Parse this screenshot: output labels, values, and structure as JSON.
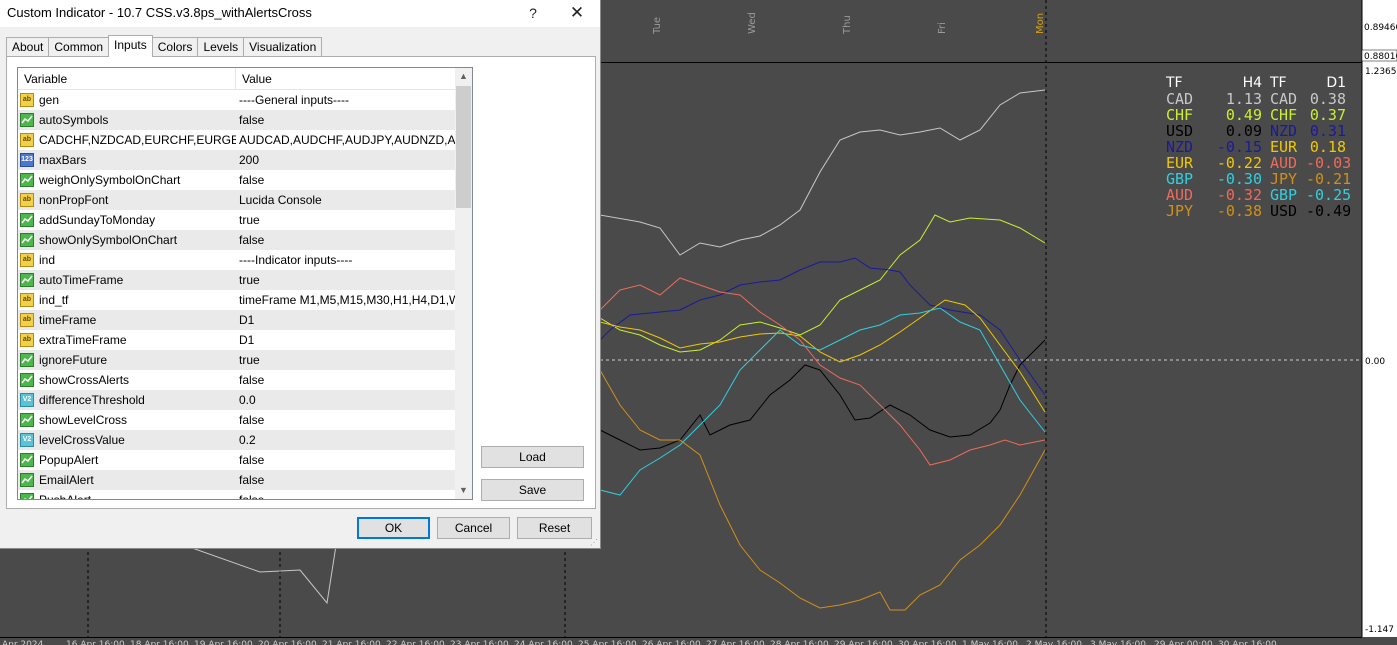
{
  "dialog": {
    "title": "Custom Indicator - 10.7 CSS.v3.8ps_withAlertsCross",
    "help_glyph": "?",
    "close_glyph": "✕",
    "tabs": [
      "About",
      "Common",
      "Inputs",
      "Colors",
      "Levels",
      "Visualization"
    ],
    "active_tab": "Inputs",
    "grid": {
      "col_variable": "Variable",
      "col_value": "Value",
      "rows": [
        {
          "type": "ab",
          "variable": "gen",
          "value": "----General inputs----"
        },
        {
          "type": "bool",
          "variable": "autoSymbols",
          "value": "false"
        },
        {
          "type": "ab",
          "variable": "CADCHF,NZDCAD,EURCHF,EURGBP,",
          "value": "AUDCAD,AUDCHF,AUDJPY,AUDNZD,A..."
        },
        {
          "type": "int",
          "variable": "maxBars",
          "value": "200"
        },
        {
          "type": "bool",
          "variable": "weighOnlySymbolOnChart",
          "value": "false"
        },
        {
          "type": "ab",
          "variable": "nonPropFont",
          "value": "Lucida Console"
        },
        {
          "type": "bool",
          "variable": "addSundayToMonday",
          "value": "true"
        },
        {
          "type": "bool",
          "variable": "showOnlySymbolOnChart",
          "value": "false"
        },
        {
          "type": "ab",
          "variable": "ind",
          "value": "----Indicator inputs----"
        },
        {
          "type": "bool",
          "variable": "autoTimeFrame",
          "value": "true"
        },
        {
          "type": "ab",
          "variable": "ind_tf",
          "value": "timeFrame M1,M5,M15,M30,H1,H4,D1,W..."
        },
        {
          "type": "ab",
          "variable": "timeFrame",
          "value": "D1"
        },
        {
          "type": "ab",
          "variable": "extraTimeFrame",
          "value": "D1"
        },
        {
          "type": "bool",
          "variable": "ignoreFuture",
          "value": "true"
        },
        {
          "type": "bool",
          "variable": "showCrossAlerts",
          "value": "false"
        },
        {
          "type": "dbl",
          "variable": "differenceThreshold",
          "value": "0.0"
        },
        {
          "type": "bool",
          "variable": "showLevelCross",
          "value": "false"
        },
        {
          "type": "dbl",
          "variable": "levelCrossValue",
          "value": "0.2"
        },
        {
          "type": "bool",
          "variable": "PopupAlert",
          "value": "false"
        },
        {
          "type": "bool",
          "variable": "EmailAlert",
          "value": "false"
        },
        {
          "type": "bool",
          "variable": "PushAlert",
          "value": "false"
        }
      ]
    },
    "buttons": {
      "load": "Load",
      "save": "Save",
      "ok": "OK",
      "cancel": "Cancel",
      "reset": "Reset"
    }
  },
  "chart": {
    "price_labels": [
      "0.89460",
      "0.88010",
      "1.2365",
      "0.00",
      "-1.147"
    ],
    "day_labels": [
      "Tue",
      "Wed",
      "Thu",
      "Fri",
      "Mon"
    ],
    "date_labels": [
      "Apr 2024",
      "16 Apr 16:00",
      "18 Apr 16:00",
      "19 Apr 16:00",
      "20 Apr 16:00",
      "21 Apr 16:00",
      "22 Apr 16:00",
      "23 Apr 16:00",
      "24 Apr 16:00",
      "25 Apr 16:00",
      "26 Apr 16:00",
      "27 Apr 16:00",
      "28 Apr 16:00",
      "29 Apr 16:00",
      "30 Apr 16:00",
      "1 May 16:00",
      "2 May 16:00",
      "3 May 16:00",
      "29 Apr 00:00",
      "30 Apr 16:00"
    ],
    "colors": {
      "CAD": "#c8c8c8",
      "CHF": "#c8f030",
      "USD": "#000000",
      "NZD": "#1a1a9a",
      "EUR": "#f0c800",
      "GBP": "#30d0e0",
      "AUD": "#f06a5a",
      "JPY": "#d0901a"
    }
  },
  "strength": {
    "header": {
      "tf1": "TF",
      "tf1_val": "H4",
      "tf2": "TF",
      "tf2_val": "D1"
    },
    "left": [
      {
        "cur": "CAD",
        "val": "1.13"
      },
      {
        "cur": "CHF",
        "val": "0.49"
      },
      {
        "cur": "USD",
        "val": "0.09"
      },
      {
        "cur": "NZD",
        "val": "-0.15"
      },
      {
        "cur": "EUR",
        "val": "-0.22"
      },
      {
        "cur": "GBP",
        "val": "-0.30"
      },
      {
        "cur": "AUD",
        "val": "-0.32"
      },
      {
        "cur": "JPY",
        "val": "-0.38"
      }
    ],
    "right": [
      {
        "cur": "CAD",
        "val": "0.38"
      },
      {
        "cur": "CHF",
        "val": "0.37"
      },
      {
        "cur": "NZD",
        "val": "0.31"
      },
      {
        "cur": "EUR",
        "val": "0.18"
      },
      {
        "cur": "AUD",
        "val": "-0.03"
      },
      {
        "cur": "JPY",
        "val": "-0.21"
      },
      {
        "cur": "GBP",
        "val": "-0.25"
      },
      {
        "cur": "USD",
        "val": "-0.49"
      }
    ]
  }
}
